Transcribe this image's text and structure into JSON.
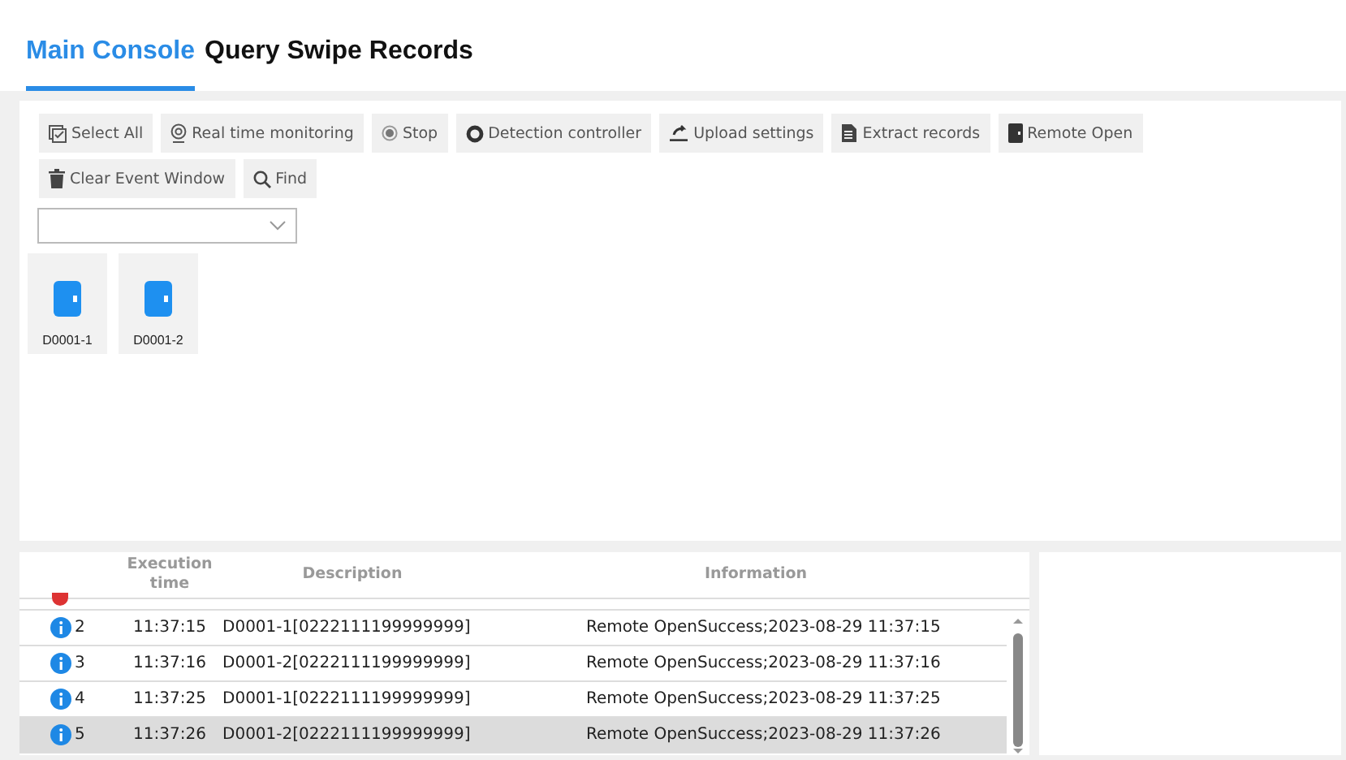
{
  "tabs": [
    {
      "label": "Main Console",
      "selected": true
    },
    {
      "label": "Query Swipe Records",
      "selected": false
    }
  ],
  "toolbar": [
    {
      "label": "Select All",
      "kind": "select"
    },
    {
      "label": "Real time monitoring",
      "kind": "monitor"
    },
    {
      "label": "Stop",
      "kind": "stop"
    },
    {
      "label": "Detection controller",
      "kind": "detect"
    },
    {
      "label": "Upload settings",
      "kind": "upload"
    },
    {
      "label": "Extract records",
      "kind": "extract"
    },
    {
      "label": "Remote Open",
      "kind": "door"
    },
    {
      "label": "Clear Event Window",
      "kind": "trash"
    },
    {
      "label": "Find",
      "kind": "search"
    }
  ],
  "doors": [
    {
      "label": "D0001-1"
    },
    {
      "label": "D0001-2"
    }
  ],
  "events": {
    "columns": [
      "Execution time",
      "Description",
      "Information"
    ],
    "rows": [
      {
        "index": "2",
        "time": "11:37:15",
        "description": "D0001-1[0222111199999999]",
        "information": "Remote OpenSuccess;2023-08-29 11:37:15",
        "selected": false
      },
      {
        "index": "3",
        "time": "11:37:16",
        "description": "D0001-2[0222111199999999]",
        "information": "Remote OpenSuccess;2023-08-29 11:37:16",
        "selected": false
      },
      {
        "index": "4",
        "time": "11:37:25",
        "description": "D0001-1[0222111199999999]",
        "information": "Remote OpenSuccess;2023-08-29 11:37:25",
        "selected": false
      },
      {
        "index": "5",
        "time": "11:37:26",
        "description": "D0001-2[0222111199999999]",
        "information": "Remote OpenSuccess;2023-08-29 11:37:26",
        "selected": true
      }
    ]
  }
}
